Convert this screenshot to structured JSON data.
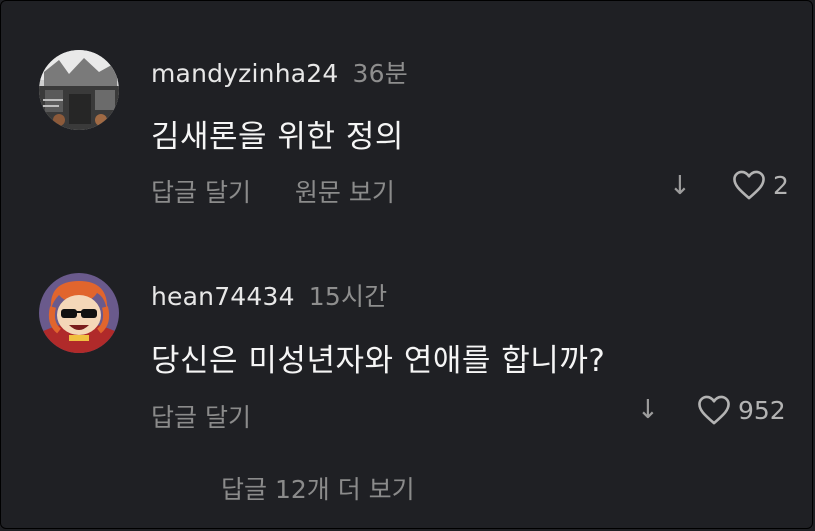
{
  "comments": [
    {
      "username": "mandyzinha24",
      "time": "36분",
      "text": "김새론을 위한 정의",
      "reply": "답글 달기",
      "view_original": "원문 보기",
      "likes": "2",
      "down_icon": "↓"
    },
    {
      "username": "hean74434",
      "time": "15시간",
      "text": "당신은 미성년자와 연애를 합니까?",
      "reply": "답글 달기",
      "likes": "952",
      "down_icon": "↓"
    }
  ],
  "more_replies": "답글 12개 더 보기",
  "icons": [
    "heart-icon",
    "arrow-down-icon"
  ],
  "colors": {
    "background": "#1f2024",
    "muted": "#8b8b8b",
    "text": "#f5f5f5"
  }
}
